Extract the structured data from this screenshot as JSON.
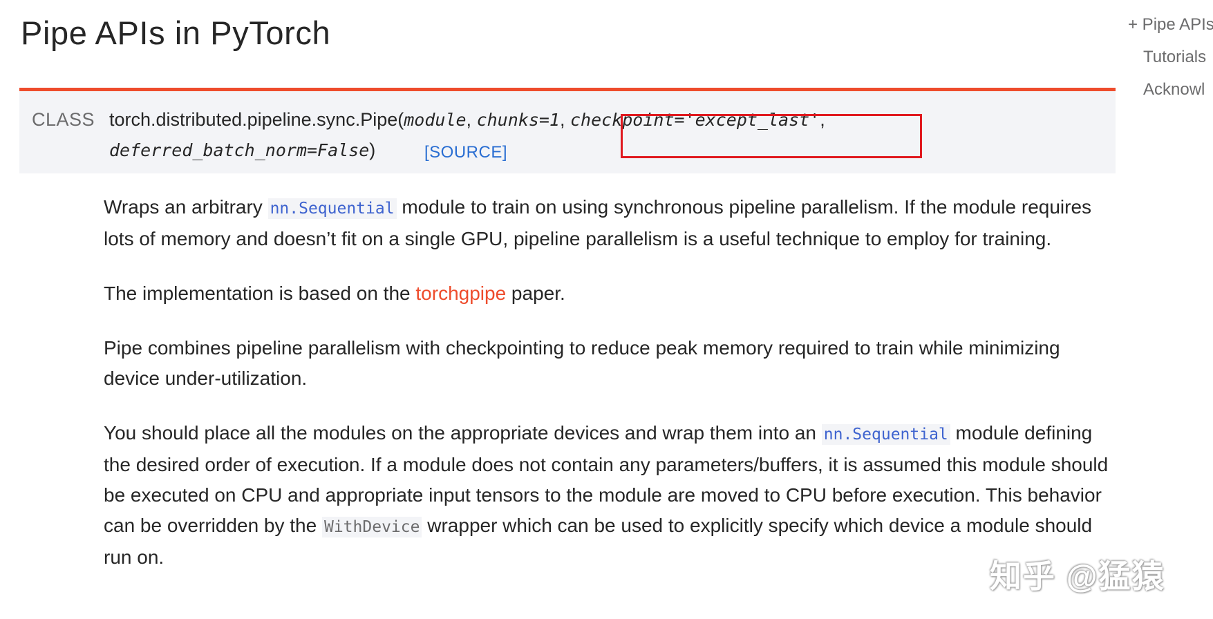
{
  "page": {
    "title": "Pipe APIs in PyTorch"
  },
  "toc": {
    "items": [
      {
        "label": "+ Pipe APIs"
      },
      {
        "label": "Tutorials"
      },
      {
        "label": "Acknowl"
      }
    ]
  },
  "class_signature": {
    "label": "CLASS",
    "name": "torch.distributed.pipeline.sync.Pipe",
    "open_paren": "(",
    "params": [
      "module",
      "chunks=1",
      "checkpoint='except_last'",
      "deferred_batch_norm=False"
    ],
    "comma1": ", ",
    "comma2": ", ",
    "comma3": ",",
    "close_paren": ")",
    "source_label": "[SOURCE]",
    "highlight_color": "#e0191f"
  },
  "description": {
    "p1": {
      "before": "Wraps an arbitrary ",
      "code": "nn.Sequential",
      "after": " module to train on using synchronous pipeline parallelism. If the module requires lots of memory and doesn’t fit on a single GPU, pipeline parallelism is a useful technique to employ for training."
    },
    "p2": {
      "before": "The implementation is based on the ",
      "link": "torchgpipe",
      "after": " paper."
    },
    "p3": {
      "text": "Pipe combines pipeline parallelism with checkpointing to reduce peak memory required to train while minimizing device under-utilization."
    },
    "p4": {
      "before": "You should place all the modules on the appropriate devices and wrap them into an ",
      "code": "nn.Sequential",
      "middle": " module defining the desired order of execution. If a module does not contain any parameters/buffers, it is assumed this module should be executed on CPU and appropriate input tensors to the module are moved to CPU before execution. This behavior can be overridden by the ",
      "code2": "WithDevice",
      "after": " wrapper which can be used to explicitly specify which device a module should run on."
    }
  },
  "watermark": {
    "text": "知乎 @猛猿"
  },
  "colors": {
    "accent": "#ee4c2c",
    "link": "#2a6ed2",
    "code": "#3e63cf",
    "class_bg": "#f3f4f7"
  }
}
